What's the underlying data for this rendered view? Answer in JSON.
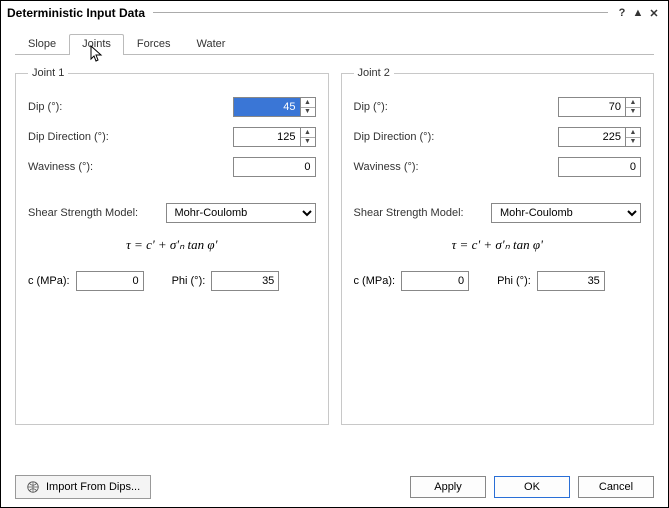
{
  "window": {
    "title": "Deterministic Input Data",
    "help_label": "?",
    "min_label": "▲",
    "close_label": "✕"
  },
  "tabs": {
    "items": [
      "Slope",
      "Joints",
      "Forces",
      "Water"
    ],
    "active_index": 1
  },
  "joints": [
    {
      "legend": "Joint 1",
      "dip_label": "Dip (°):",
      "dip_value": "45",
      "dipdir_label": "Dip Direction (°):",
      "dipdir_value": "125",
      "wav_label": "Waviness (°):",
      "wav_value": "0",
      "ssm_label": "Shear Strength Model:",
      "ssm_value": "Mohr-Coulomb",
      "formula": "τ = c' + σ'ₙ tan φ'",
      "c_label": "c (MPa):",
      "c_value": "0",
      "phi_label": "Phi (°):",
      "phi_value": "35"
    },
    {
      "legend": "Joint 2",
      "dip_label": "Dip (°):",
      "dip_value": "70",
      "dipdir_label": "Dip Direction (°):",
      "dipdir_value": "225",
      "wav_label": "Waviness (°):",
      "wav_value": "0",
      "ssm_label": "Shear Strength Model:",
      "ssm_value": "Mohr-Coulomb",
      "formula": "τ = c' + σ'ₙ tan φ'",
      "c_label": "c (MPa):",
      "c_value": "0",
      "phi_label": "Phi (°):",
      "phi_value": "35"
    }
  ],
  "footer": {
    "import_label": "Import From Dips...",
    "apply": "Apply",
    "ok": "OK",
    "cancel": "Cancel"
  }
}
